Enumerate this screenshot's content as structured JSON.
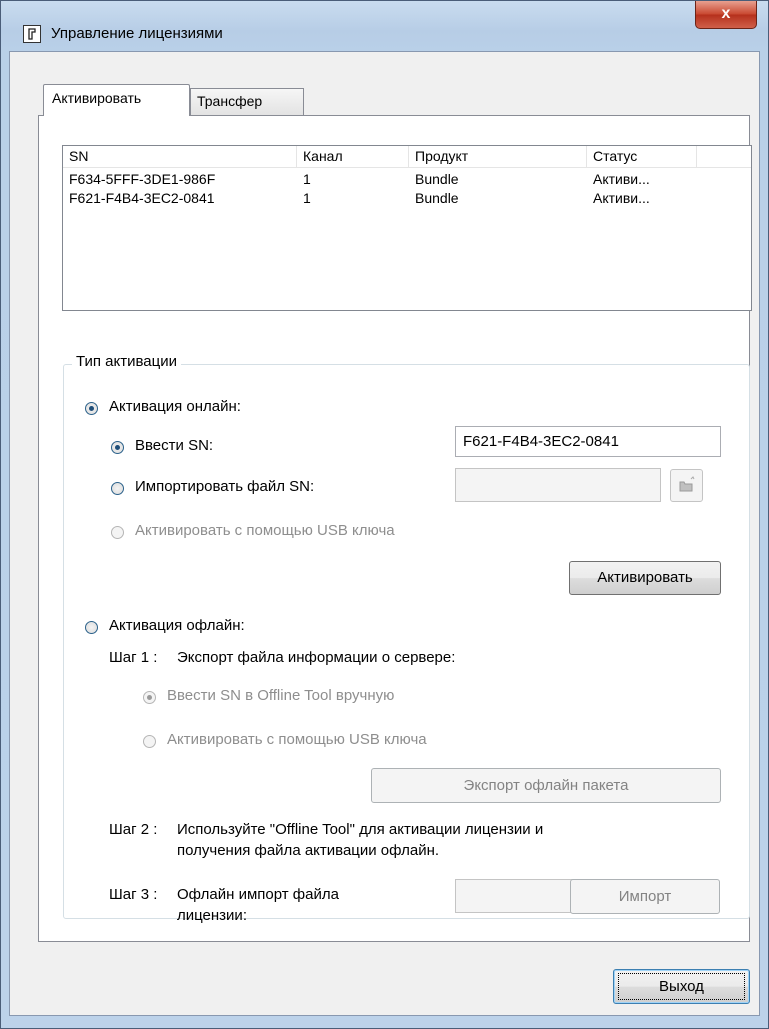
{
  "window": {
    "title": "Управление лицензиями",
    "close_label": "x"
  },
  "tabs": [
    {
      "label": "Активировать",
      "active": true
    },
    {
      "label": "Трансфер",
      "active": false
    }
  ],
  "licenses": {
    "columns": [
      "SN",
      "Канал",
      "Продукт",
      "Статус"
    ],
    "rows": [
      [
        "F634-5FFF-3DE1-986F",
        "1",
        "Bundle",
        "Активи..."
      ],
      [
        "F621-F4B4-3EC2-0841",
        "1",
        "Bundle",
        "Активи..."
      ]
    ]
  },
  "activation": {
    "group_title": "Тип активации",
    "online": {
      "label": "Активация онлайн:",
      "checked": true,
      "enter_sn_label": "Ввести SN:",
      "enter_sn_checked": true,
      "sn_value": "F621-F4B4-3EC2-0841",
      "import_file_label": "Импортировать файл SN:",
      "usb_label": "Активировать с помощью USB ключа",
      "activate_button": "Активировать"
    },
    "offline": {
      "label": "Активация офлайн:",
      "checked": false,
      "step1_label": "Шаг 1 :",
      "step1_text": "Экспорт файла информации о сервере:",
      "manual_sn_label": "Ввести SN в Offline Tool вручную",
      "usb_label": "Активировать с помощью USB ключа",
      "export_button": "Экспорт офлайн пакета",
      "step2_label": "Шаг 2 :",
      "step2_text_line1": "Используйте \"Offline Tool\" для активации лицензии и",
      "step2_text_line2": "получения файла активации офлайн.",
      "step3_label": "Шаг 3 :",
      "step3_text_line1": "Офлайн импорт файла",
      "step3_text_line2": "лицензии:",
      "import_button": "Импорт"
    }
  },
  "footer": {
    "exit_button": "Выход"
  },
  "colors": {
    "title_bar": "#b9d0e8",
    "close_button": "#c8462e",
    "dialog_bg": "#f0f0f0",
    "disabled_text": "#8e8e8e"
  }
}
